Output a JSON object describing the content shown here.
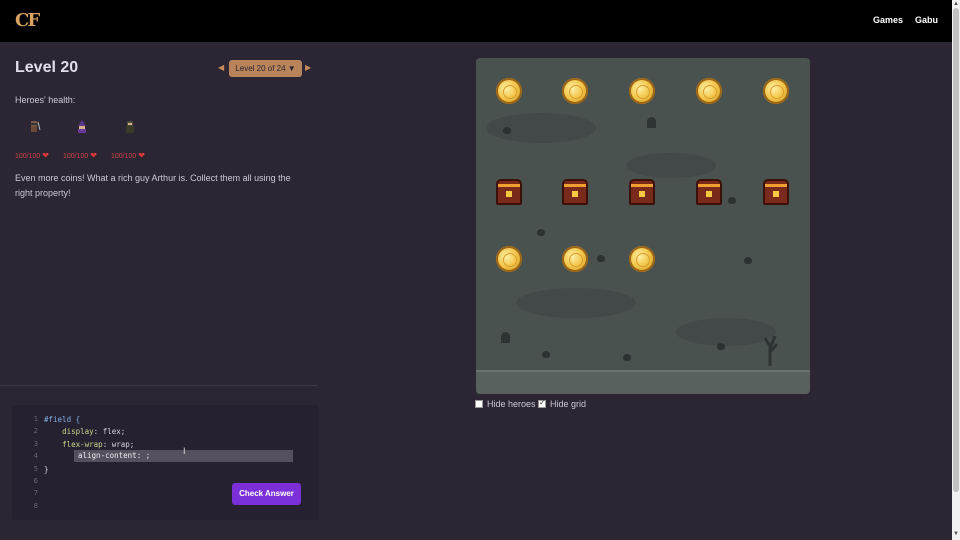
{
  "nav": {
    "logo": "CF",
    "games_link": "Games",
    "user_link": "Gabu"
  },
  "level": {
    "title": "Level 20",
    "selector_label": "Level 20 of 24 ▼",
    "prev_arrow": "◀",
    "next_arrow": "▶",
    "health_label": "Heroes' health:",
    "instructions": "Even more coins! What a rich guy Arthur is. Collect them all using the right property!"
  },
  "heroes": [
    {
      "name": "warrior",
      "hp": "100/100"
    },
    {
      "name": "wizard",
      "hp": "100/100"
    },
    {
      "name": "rogue",
      "hp": "100/100"
    }
  ],
  "editor": {
    "line_numbers": [
      "1",
      "2",
      "3",
      "4",
      "5",
      "6",
      "7",
      "8"
    ],
    "selector": "#field {",
    "line2_prop": "display",
    "line2_val": "flex;",
    "line3_prop": "flex-wrap",
    "line3_val": "wrap;",
    "input_value": "align-content: ;",
    "close": "}",
    "check_button": "Check Answer"
  },
  "field": {
    "rows": [
      [
        "coin",
        "coin",
        "coin",
        "coin",
        "coin"
      ],
      [
        "chest",
        "chest",
        "chest",
        "chest",
        "chest"
      ],
      [
        "coin",
        "coin",
        "coin"
      ]
    ]
  },
  "options": {
    "hide_heroes": {
      "label": "Hide heroes",
      "checked": false
    },
    "hide_grid": {
      "label": "Hide grid",
      "checked": true
    }
  },
  "colors": {
    "accent": "#7b2fd9",
    "selector_bg": "#b9845a",
    "heart": "#e03a3a"
  }
}
